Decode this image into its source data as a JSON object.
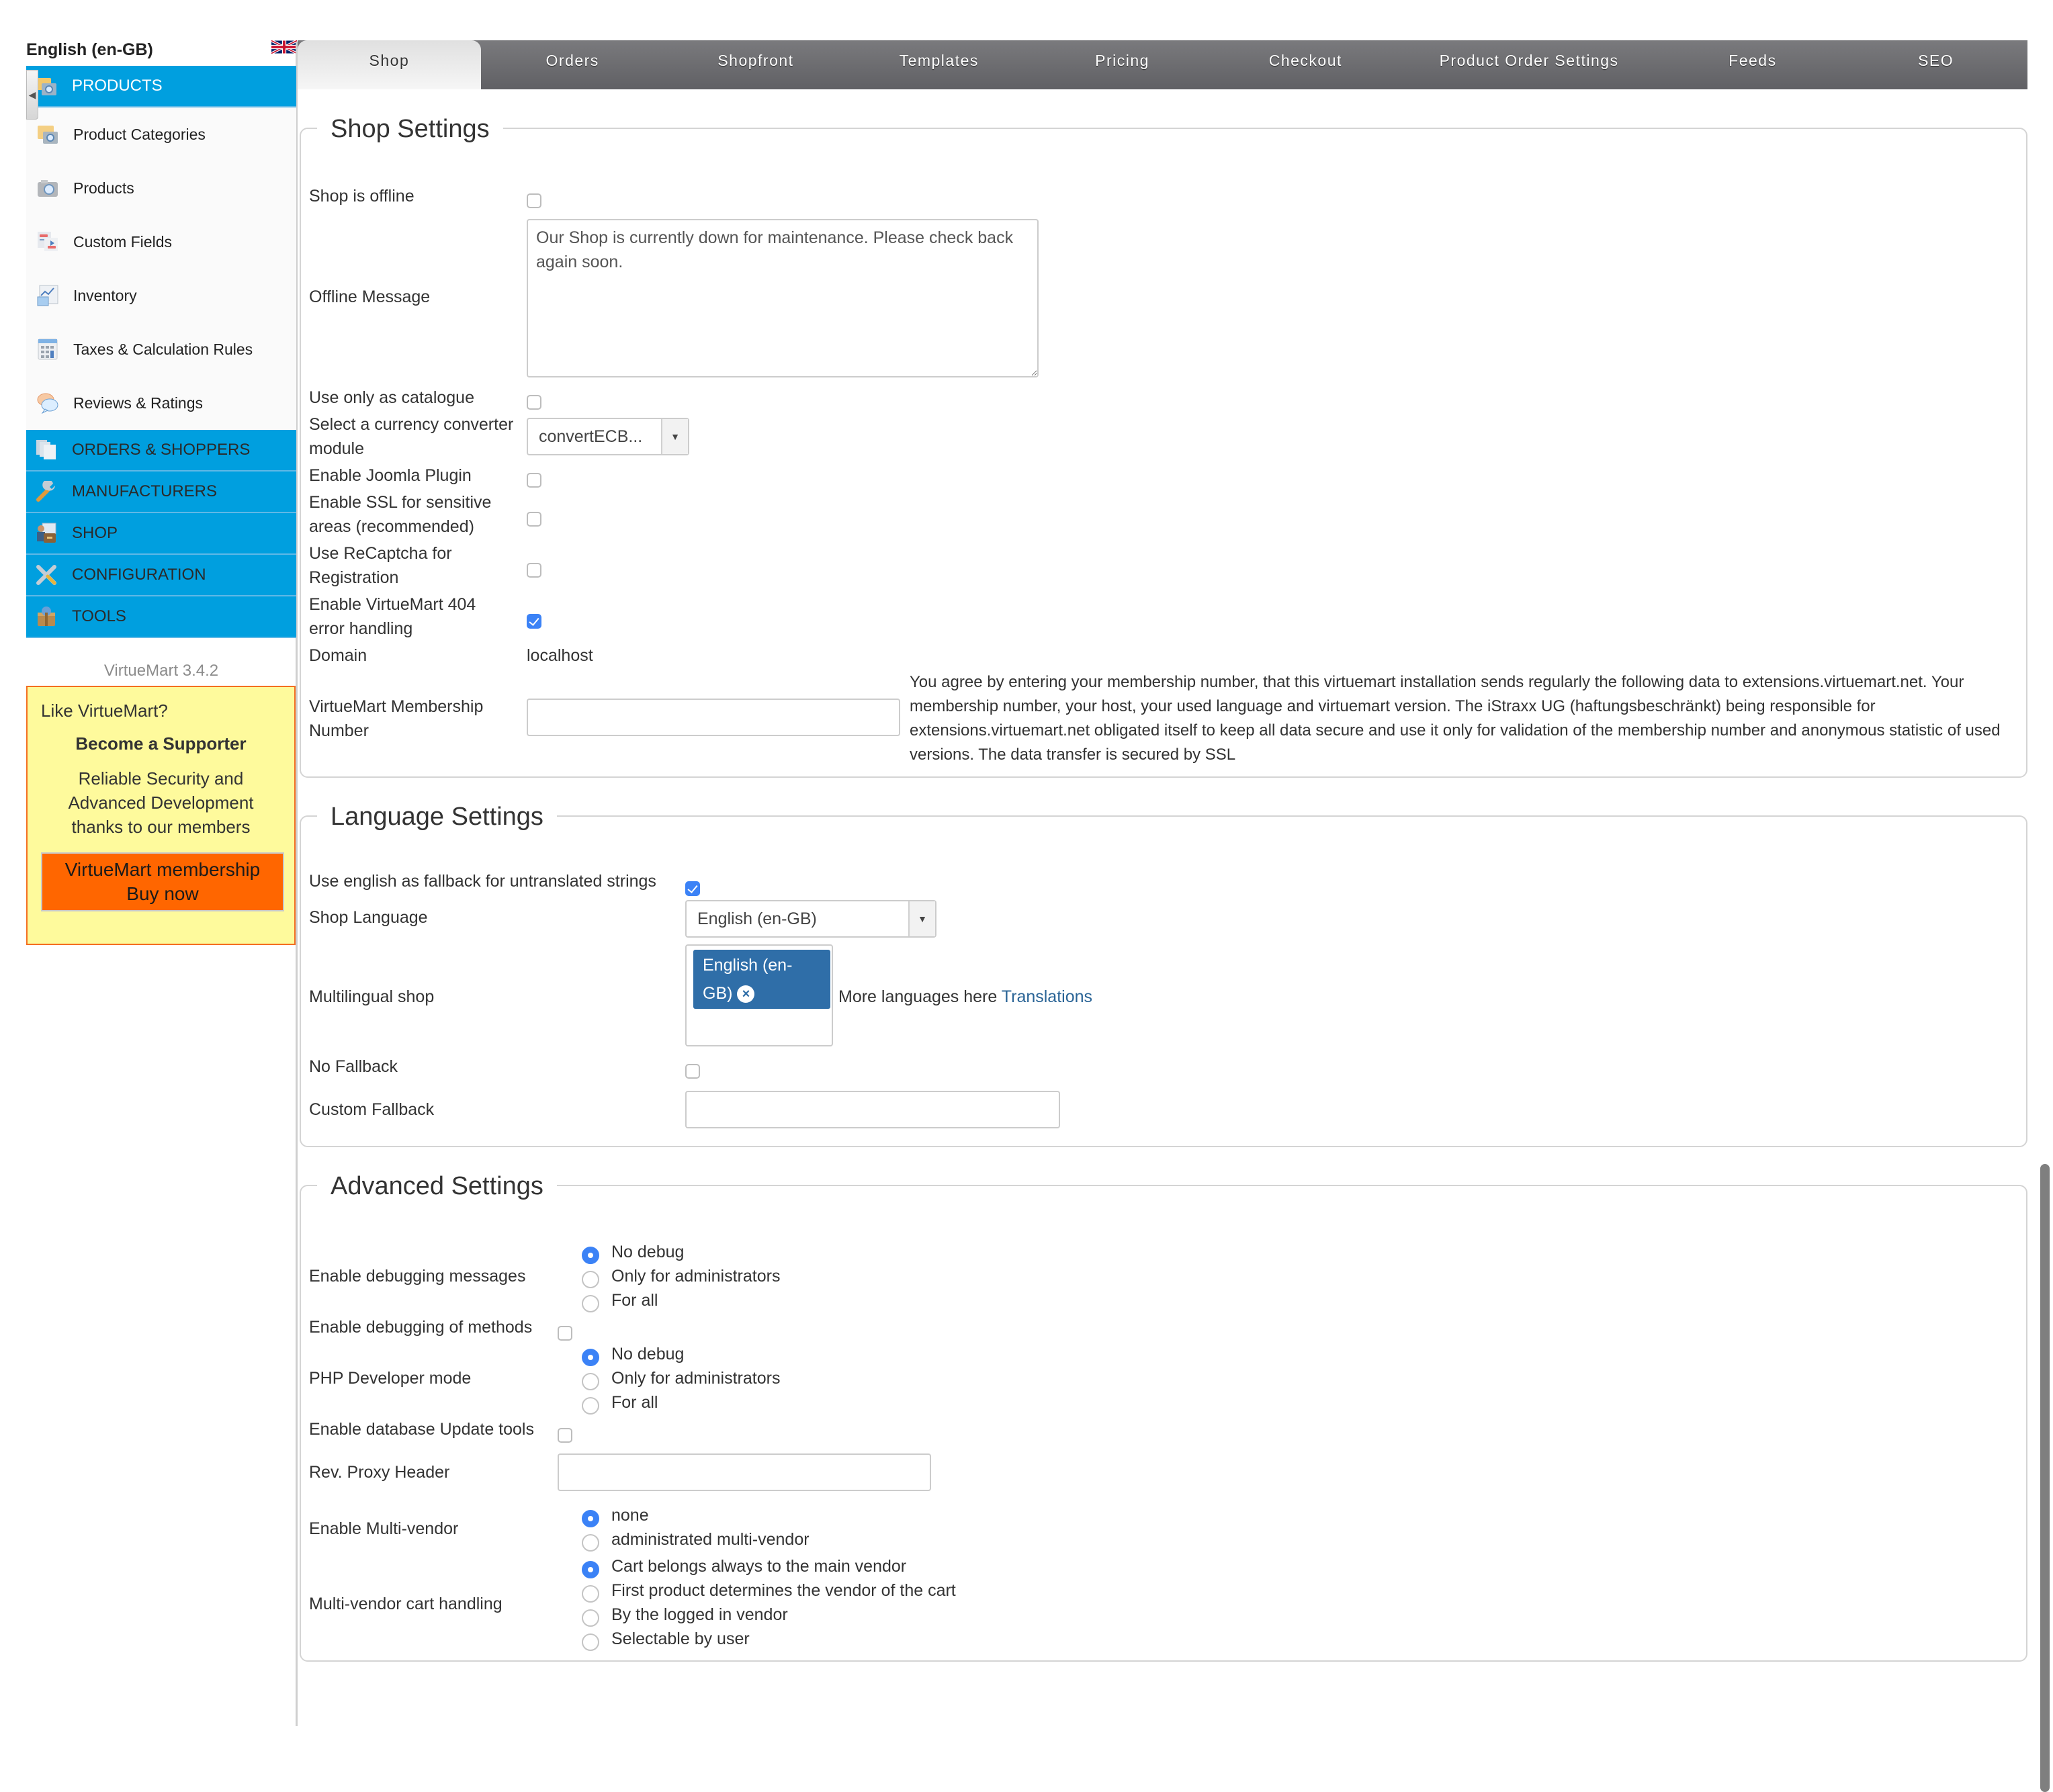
{
  "sidebar": {
    "language": "English (en-GB)",
    "flag_icon": "uk-flag-icon",
    "menu": {
      "products": {
        "label": "PRODUCTS",
        "items": [
          {
            "label": "Product Categories",
            "icon": "folder-camera-icon"
          },
          {
            "label": "Products",
            "icon": "camera-icon"
          },
          {
            "label": "Custom Fields",
            "icon": "custom-fields-icon"
          },
          {
            "label": "Inventory",
            "icon": "chart-icon"
          },
          {
            "label": "Taxes & Calculation Rules",
            "icon": "calculator-icon"
          },
          {
            "label": "Reviews & Ratings",
            "icon": "speech-bubbles-icon"
          }
        ]
      },
      "sections": [
        {
          "label": "ORDERS & SHOPPERS",
          "icon": "documents-icon"
        },
        {
          "label": "MANUFACTURERS",
          "icon": "wrench-icon"
        },
        {
          "label": "SHOP",
          "icon": "shop-briefcase-icon"
        },
        {
          "label": "CONFIGURATION",
          "icon": "tools-icon"
        },
        {
          "label": "TOOLS",
          "icon": "package-icon"
        }
      ]
    },
    "version": "VirtueMart 3.4.2",
    "support": {
      "like": "Like VirtueMart?",
      "become": "Become a Supporter",
      "reliable": "Reliable Security and Advanced Development thanks to our members",
      "buy_line1": "VirtueMart membership",
      "buy_line2": "Buy now"
    }
  },
  "tabs": [
    {
      "label": "Shop",
      "active": true
    },
    {
      "label": "Orders",
      "active": false
    },
    {
      "label": "Shopfront",
      "active": false
    },
    {
      "label": "Templates",
      "active": false
    },
    {
      "label": "Pricing",
      "active": false
    },
    {
      "label": "Checkout",
      "active": false
    },
    {
      "label": "Product Order Settings",
      "active": false
    },
    {
      "label": "Feeds",
      "active": false
    },
    {
      "label": "SEO",
      "active": false
    }
  ],
  "shop_settings": {
    "legend": "Shop Settings",
    "shop_offline": {
      "label": "Shop is offline",
      "checked": false
    },
    "offline_message": {
      "label": "Offline Message",
      "value": "Our Shop is currently down for maintenance. Please check back again soon."
    },
    "catalogue_only": {
      "label": "Use only as catalogue",
      "checked": false
    },
    "currency_converter": {
      "label": "Select a currency converter module",
      "value": "convertECB..."
    },
    "joomla_plugin": {
      "label": "Enable Joomla Plugin",
      "checked": false
    },
    "ssl": {
      "label": "Enable SSL for sensitive areas (recommended)",
      "checked": false
    },
    "recaptcha": {
      "label": "Use ReCaptcha for Registration",
      "checked": false
    },
    "error_404": {
      "label": "Enable VirtueMart 404 error handling",
      "checked": true
    },
    "domain": {
      "label": "Domain",
      "value": "localhost"
    },
    "membership": {
      "label": "VirtueMart Membership Number",
      "value": "",
      "note": "You agree by entering your membership number, that this virtuemart installation sends regularly the following data to extensions.virtuemart.net. Your membership number, your host, your used language and virtuemart version. The iStraxx UG (haftungsbeschränkt) being responsible for extensions.virtuemart.net obligated itself to keep all data secure and use it only for validation of the membership number and anonymous statistic of used versions. The data transfer is secured by SSL"
    }
  },
  "language_settings": {
    "legend": "Language Settings",
    "english_fallback": {
      "label": "Use english as fallback for untranslated strings",
      "checked": true
    },
    "shop_language": {
      "label": "Shop Language",
      "value": "English (en-GB)"
    },
    "multilingual": {
      "label": "Multilingual shop",
      "selected_chip": "English (en-GB)",
      "more_text": "More languages here",
      "link_text": "Translations"
    },
    "no_fallback": {
      "label": "No Fallback",
      "checked": false
    },
    "custom_fallback": {
      "label": "Custom Fallback",
      "value": ""
    }
  },
  "advanced_settings": {
    "legend": "Advanced Settings",
    "debug_messages": {
      "label": "Enable debugging messages",
      "options": [
        "No debug",
        "Only for administrators",
        "For all"
      ],
      "selected": 0
    },
    "debug_methods": {
      "label": "Enable debugging of methods",
      "checked": false
    },
    "php_dev_mode": {
      "label": "PHP Developer mode",
      "options": [
        "No debug",
        "Only for administrators",
        "For all"
      ],
      "selected": 0
    },
    "db_update_tools": {
      "label": "Enable database Update tools",
      "checked": false
    },
    "rev_proxy": {
      "label": "Rev. Proxy Header",
      "value": ""
    },
    "multi_vendor": {
      "label": "Enable Multi-vendor",
      "options": [
        "none",
        "administrated multi-vendor"
      ],
      "selected": 0
    },
    "cart_handling": {
      "label": "Multi-vendor cart handling",
      "options": [
        "Cart belongs always to the main vendor",
        "First product determines the vendor of the cart",
        "By the logged in vendor",
        "Selectable by user"
      ],
      "selected": 0
    }
  },
  "colors": {
    "accent_blue": "#009fdf",
    "checkbox_blue": "#3b82f6",
    "chip_blue": "#2f6ea8",
    "support_bg": "#fefa9c",
    "support_border": "#f36f21",
    "buy_button": "#ff6600",
    "tab_bar": "#6c6c70"
  }
}
